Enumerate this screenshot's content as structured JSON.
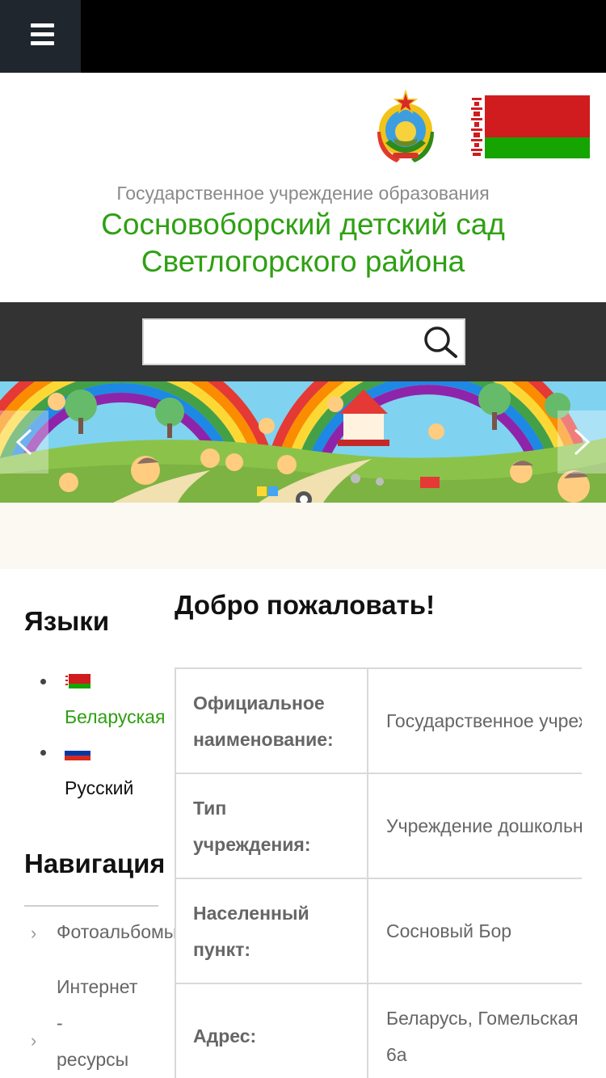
{
  "header": {
    "org_type": "Государственное учреждение образования",
    "org_name_line1": "Сосновоборский детский сад",
    "org_name_line2": "Светлогорского района"
  },
  "search": {
    "placeholder": ""
  },
  "sidebar": {
    "languages_heading": "Языки",
    "languages": [
      {
        "label": "Беларуская",
        "color": "#2ea012",
        "flag": "belarus-flag-icon"
      },
      {
        "label": "Русский",
        "color": "#111111",
        "flag": "russia-flag-icon"
      }
    ],
    "navigation_heading": "Навигация",
    "nav_items": [
      {
        "label": "Фотоальбомы"
      },
      {
        "label_lines": [
          "Интернет",
          "-",
          "ресурсы"
        ]
      }
    ]
  },
  "main": {
    "welcome_title": "Добро пожаловать!",
    "info_rows": [
      {
        "label_lines": [
          "Официальное",
          "наименование:"
        ],
        "value_lines": [
          "Государственное учреждение образования"
        ]
      },
      {
        "label_lines": [
          "Тип",
          "учреждения:"
        ],
        "value_lines": [
          "Учреждение дошкольного образования"
        ]
      },
      {
        "label_lines": [
          "Населенный",
          "пункт:"
        ],
        "value_lines": [
          "Сосновый Бор"
        ]
      },
      {
        "label_lines": [
          "Адрес:"
        ],
        "value_lines": [
          "Беларусь, Гомельская область",
          "6а"
        ]
      }
    ]
  },
  "colors": {
    "accent_green": "#2ea012",
    "topbar": "#000000",
    "search_strip": "#333333"
  }
}
